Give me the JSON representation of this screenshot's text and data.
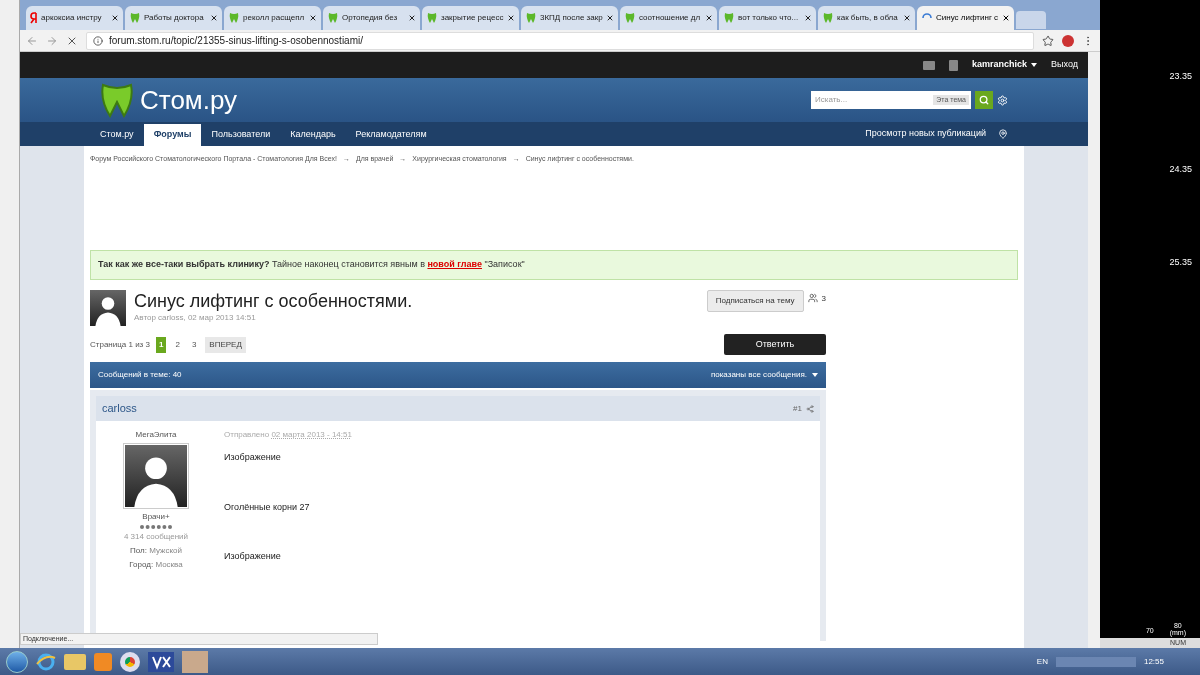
{
  "browser": {
    "tabs": [
      {
        "label": "аркоксиа инстру",
        "kind": "yandex",
        "selected": false
      },
      {
        "label": "Работы доктора",
        "kind": "site",
        "selected": false
      },
      {
        "label": "реколл расщепл",
        "kind": "site",
        "selected": false
      },
      {
        "label": "Ортопедия без",
        "kind": "site",
        "selected": false
      },
      {
        "label": "закрытие рецесс",
        "kind": "site",
        "selected": false
      },
      {
        "label": "3КПД после закр",
        "kind": "site",
        "selected": false
      },
      {
        "label": "соотношение дл",
        "kind": "site",
        "selected": false
      },
      {
        "label": "вот только что...",
        "kind": "site",
        "selected": false
      },
      {
        "label": "как быть, в обла",
        "kind": "site",
        "selected": false
      },
      {
        "label": "Синус лифтинг с",
        "kind": "loading",
        "selected": true
      }
    ],
    "url": "forum.stom.ru/topic/21355-sinus-lifting-s-osobennostiami/",
    "status": "Подключение..."
  },
  "site": {
    "user": "kamranchick",
    "logout": "Выход",
    "logo": "Стом.ру",
    "search": {
      "placeholder": "Искать...",
      "scope": "Эта тема"
    },
    "nav": [
      {
        "label": "Стом.ру",
        "selected": false
      },
      {
        "label": "Форумы",
        "selected": true
      },
      {
        "label": "Пользователи",
        "selected": false
      },
      {
        "label": "Календарь",
        "selected": false
      },
      {
        "label": "Рекламодателям",
        "selected": false
      }
    ],
    "nav_right": "Просмотр новых публикаций",
    "breadcrumbs": [
      "Форум Российского Стоматологического Портала - Стоматология Для Всех!",
      "Для врачей",
      "Хирургическая стоматология",
      "Синус лифтинг с особенностями."
    ],
    "breadcrumb_separator": "→",
    "notice": {
      "lead": "Так как же все-таки выбрать клинику?",
      "before": " Тайное наконец становится явным в ",
      "link": "новой главе",
      "after": " \"Записок\""
    }
  },
  "topic": {
    "title": "Синус лифтинг с особенностями.",
    "meta": "Автор carloss, 02 мар 2013 14:51",
    "subscribe": "Подписаться на тему",
    "followers": "3",
    "page_label": "Страница 1 из 3",
    "pages": [
      {
        "label": "1",
        "selected": true
      },
      {
        "label": "2",
        "selected": false
      },
      {
        "label": "3",
        "selected": false
      }
    ],
    "next": "ВПЕРЕД",
    "reply": "Ответить",
    "count": "Сообщений в теме: 40",
    "filter": "показаны все сообщения."
  },
  "post": {
    "author": "carloss",
    "number": "#1",
    "group": "МегаЭлита",
    "rank": "Врачи+",
    "posts": "4 314 сообщений",
    "fields": [
      {
        "label": "Пол:",
        "value": "Мужской"
      },
      {
        "label": "Город:",
        "value": "Москва"
      }
    ],
    "posted_label": "Отправлено",
    "date": "02 марта 2013 - 14:51",
    "content": [
      "Изображение",
      "Оголённые корни 27",
      "Изображение"
    ]
  },
  "side_app": {
    "readings": [
      "23.35",
      "24.35",
      "25.35"
    ],
    "ticks": [
      "70",
      "80"
    ],
    "unit": "(mm)",
    "status": "NUM"
  },
  "taskbar": {
    "lang": "EN",
    "clock": "12:55"
  }
}
